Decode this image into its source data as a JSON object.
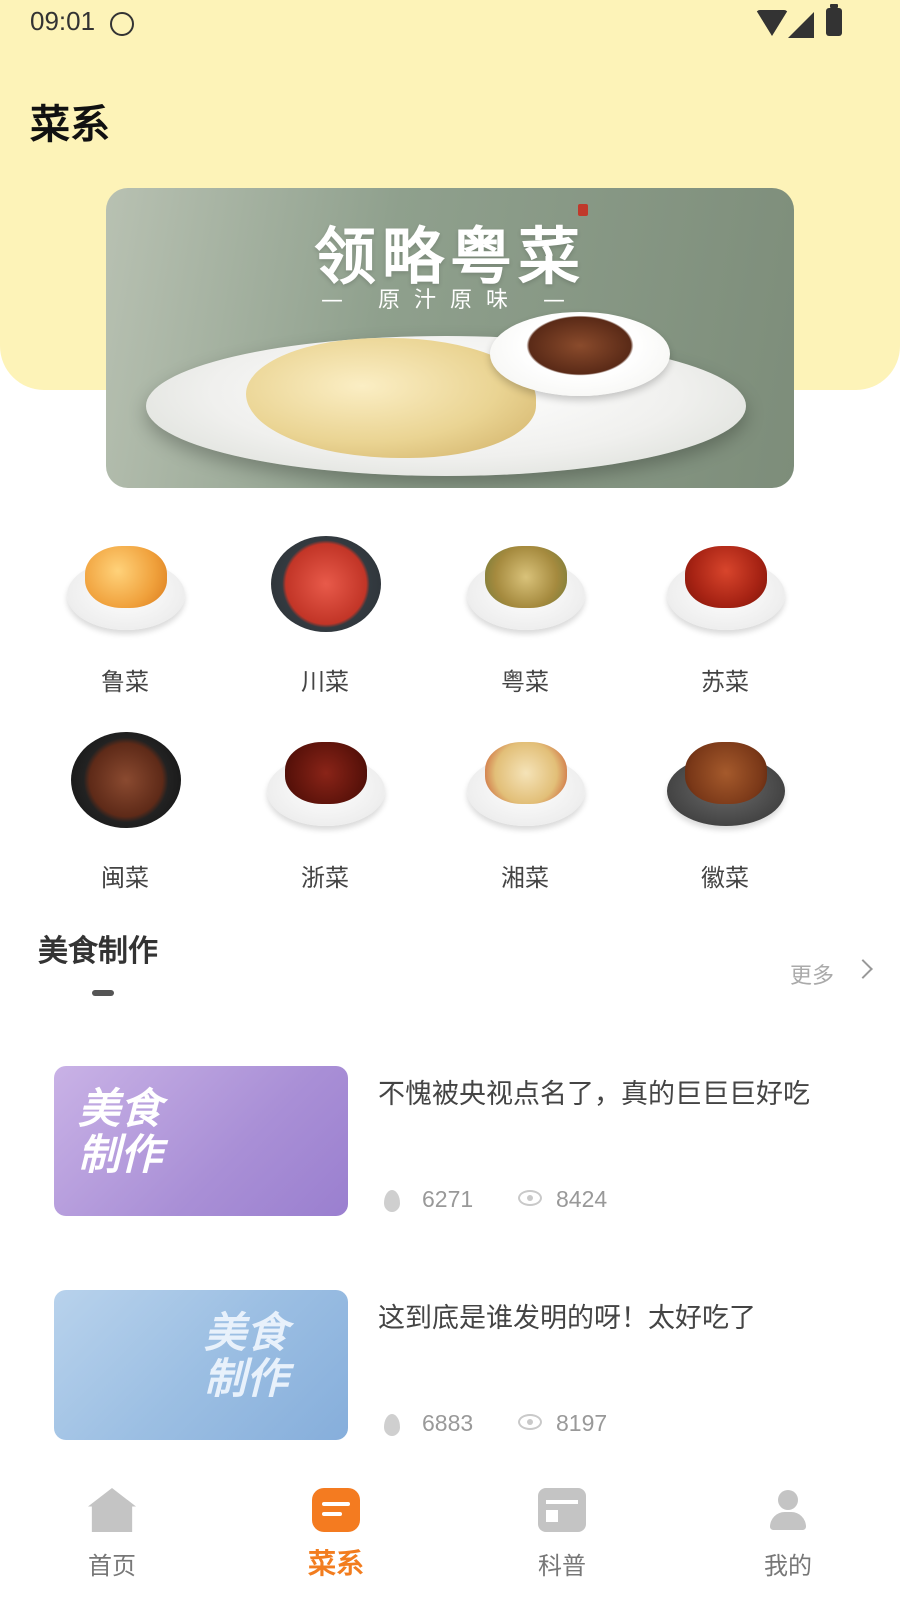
{
  "status_bar": {
    "time": "09:01"
  },
  "page": {
    "title": "菜系"
  },
  "banner": {
    "title": "领略粤菜",
    "subtitle": "— 原汁原味 —"
  },
  "categories": [
    {
      "label": "鲁菜"
    },
    {
      "label": "川菜"
    },
    {
      "label": "粤菜"
    },
    {
      "label": "苏菜"
    },
    {
      "label": "闽菜"
    },
    {
      "label": "浙菜"
    },
    {
      "label": "湘菜"
    },
    {
      "label": "徽菜"
    }
  ],
  "section": {
    "title": "美食制作",
    "more_label": "更多"
  },
  "articles": [
    {
      "thumb_text": "美食\n制作",
      "title": "不愧被央视点名了，真的巨巨巨好吃",
      "likes": "6271",
      "views": "8424"
    },
    {
      "thumb_text": "美食\n制作",
      "title": "这到底是谁发明的呀！太好吃了",
      "likes": "6883",
      "views": "8197"
    }
  ],
  "tabbar": {
    "items": [
      {
        "label": "首页",
        "icon": "home-icon"
      },
      {
        "label": "菜系",
        "icon": "menu-icon"
      },
      {
        "label": "科普",
        "icon": "news-icon"
      },
      {
        "label": "我的",
        "icon": "user-icon"
      }
    ],
    "active_index": 1
  },
  "colors": {
    "accent": "#f27d1f",
    "header_bg": "#fdf3b8"
  }
}
